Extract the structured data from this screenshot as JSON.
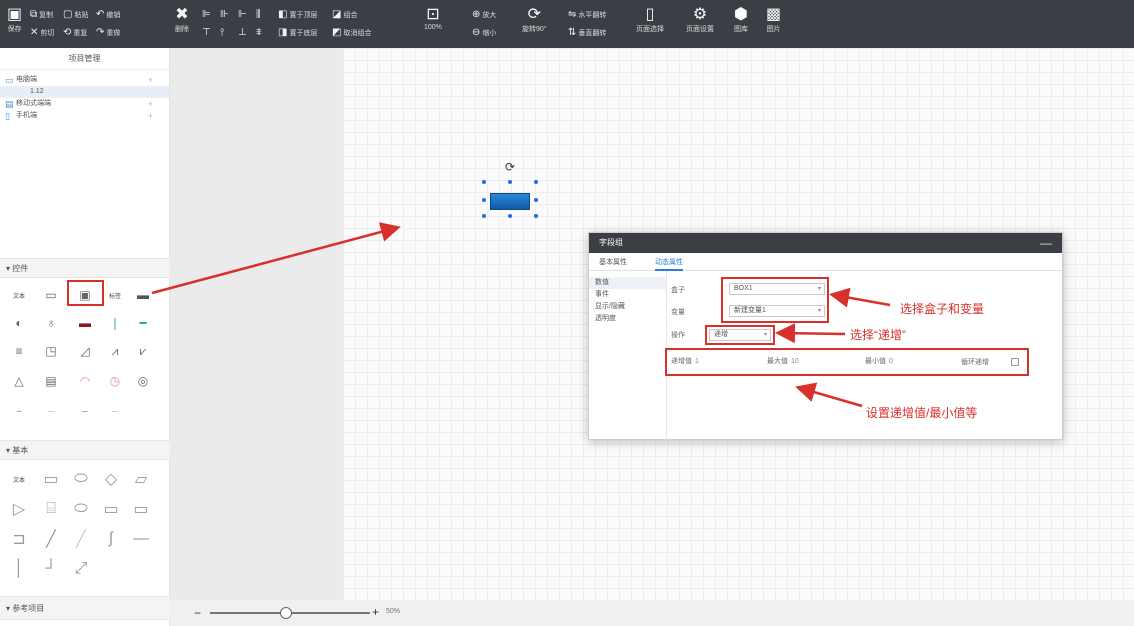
{
  "toolbar": {
    "save": "保存",
    "copy": "复制",
    "paste": "粘贴",
    "undo": "撤销",
    "cut": "剪切",
    "redo_repeat": "重复",
    "redo": "重做",
    "delete": "删除",
    "bring_front": "置于顶层",
    "send_back": "置于底层",
    "group": "组合",
    "ungroup": "取消组合",
    "zoom_percent": "100%",
    "zoom_in": "放大",
    "zoom_out": "缩小",
    "rotate": "旋转90°",
    "flip_h": "水平翻转",
    "flip_v": "垂直翻转",
    "page_select": "页面选择",
    "page_settings": "页面设置",
    "library": "图库",
    "image": "图片"
  },
  "project_panel": {
    "title": "项目管理",
    "items": [
      {
        "label": "电脑端",
        "plus": "+"
      },
      {
        "label": "1.12",
        "child": true
      },
      {
        "label": "移动式端端",
        "plus": "+"
      },
      {
        "label": "手机端",
        "plus": "+"
      }
    ]
  },
  "sections": {
    "controls": "控件",
    "basic": "基本",
    "reference": "参考项目"
  },
  "controls": {
    "text": "文本",
    "tag": "标签"
  },
  "zoom": {
    "minus": "−",
    "plus": "+",
    "value": "50%"
  },
  "dialog": {
    "title": "字段组",
    "close": "—",
    "tabs": [
      "基本属性",
      "动态属性"
    ],
    "side_items": [
      "数值",
      "事件",
      "显示/隐藏",
      "透明度"
    ],
    "box_label": "盒子",
    "box_value": "BOX1",
    "var_label": "变量",
    "var_value": "新建变量1",
    "op_label": "操作",
    "op_value": "递增",
    "step_label": "递增值",
    "step_value": "1",
    "max_label": "最大值",
    "max_value": "10",
    "min_label": "最小值",
    "min_value": "0",
    "loop_label": "循环递增"
  },
  "annotations": {
    "select_box_var": "选择盒子和变量",
    "select_increment": "选择“递增”",
    "set_values": "设置递增值/最小值等"
  }
}
